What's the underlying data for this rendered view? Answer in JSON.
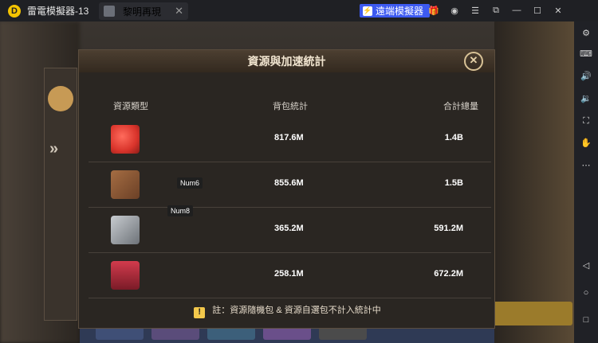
{
  "titlebar": {
    "app_name": "雷電模擬器-13",
    "tab_title": "黎明再現",
    "remote_button": "遠端模擬器"
  },
  "dialog": {
    "title": "資源與加速統計",
    "columns": [
      "資源類型",
      "背包統計",
      "合計總量"
    ],
    "rows": [
      {
        "icon": "tomato-icon",
        "backpack": "817.6M",
        "total": "1.4B"
      },
      {
        "icon": "wood-planks-icon",
        "backpack": "855.6M",
        "total": "1.5B"
      },
      {
        "icon": "steel-ingot-icon",
        "backpack": "365.2M",
        "total": "591.2M"
      },
      {
        "icon": "fuel-barrel-icon",
        "backpack": "258.1M",
        "total": "672.2M"
      }
    ],
    "note": "註：資源隨機包 & 資源自選包不計入統計中"
  },
  "keymaps": [
    "Num6",
    "Num8"
  ],
  "colors": {
    "accent": "#3d5af1",
    "tomato": "#d9342b",
    "wood": "#8a5a36",
    "steel": "#9aa0a6",
    "fuel": "#b5283a",
    "warning": "#f3c84b"
  }
}
